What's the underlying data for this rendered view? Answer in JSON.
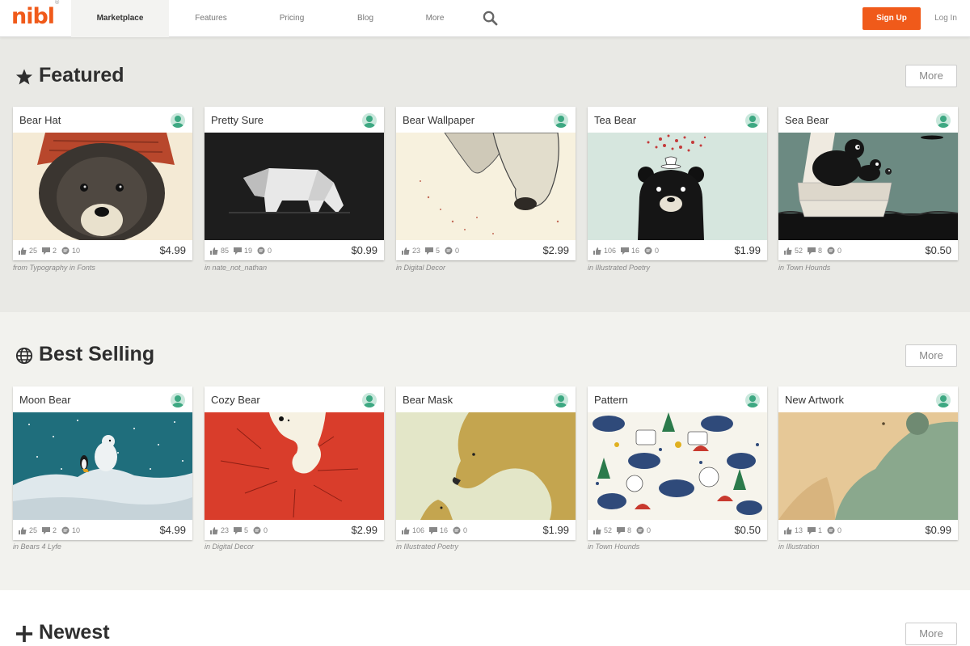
{
  "nav": {
    "logo": "nibl",
    "trademark": "®",
    "items": [
      "Marketplace",
      "Features",
      "Pricing",
      "Blog",
      "More"
    ],
    "signup": "Sign Up",
    "login": "Log In"
  },
  "colors": {
    "accent": "#f05a1a",
    "avatar": "#3da882"
  },
  "featured": {
    "title": "Featured",
    "icon": "star-icon",
    "more": "More",
    "cards": [
      {
        "title": "Bear Hat",
        "likes": "25",
        "reposts": "2",
        "comments": "10",
        "price": "$4.99",
        "caption": "from Typography in Fonts"
      },
      {
        "title": "Pretty Sure",
        "likes": "85",
        "reposts": "19",
        "comments": "0",
        "price": "$0.99",
        "caption": "in nate_not_nathan"
      },
      {
        "title": "Bear Wallpaper",
        "likes": "23",
        "reposts": "5",
        "comments": "0",
        "price": "$2.99",
        "caption": "in Digital Decor"
      },
      {
        "title": "Tea Bear",
        "likes": "106",
        "reposts": "16",
        "comments": "0",
        "price": "$1.99",
        "caption": "in Illustrated Poetry"
      },
      {
        "title": "Sea Bear",
        "likes": "52",
        "reposts": "8",
        "comments": "0",
        "price": "$0.50",
        "caption": "in Town Hounds"
      }
    ]
  },
  "best_selling": {
    "title": "Best Selling",
    "icon": "globe-icon",
    "more": "More",
    "cards": [
      {
        "title": "Moon Bear",
        "likes": "25",
        "reposts": "2",
        "comments": "10",
        "price": "$4.99",
        "caption": "in Bears 4 Lyfe"
      },
      {
        "title": "Cozy Bear",
        "likes": "23",
        "reposts": "5",
        "comments": "0",
        "price": "$2.99",
        "caption": "in Digital Decor"
      },
      {
        "title": "Bear Mask",
        "likes": "106",
        "reposts": "16",
        "comments": "0",
        "price": "$1.99",
        "caption": "in Illustrated Poetry"
      },
      {
        "title": "Pattern",
        "likes": "52",
        "reposts": "8",
        "comments": "0",
        "price": "$0.50",
        "caption": "in Town Hounds"
      },
      {
        "title": "New Artwork",
        "likes": "13",
        "reposts": "1",
        "comments": "0",
        "price": "$0.99",
        "caption": "in Illustration"
      }
    ]
  },
  "newest": {
    "title": "Newest",
    "icon": "plus-icon",
    "more": "More"
  }
}
